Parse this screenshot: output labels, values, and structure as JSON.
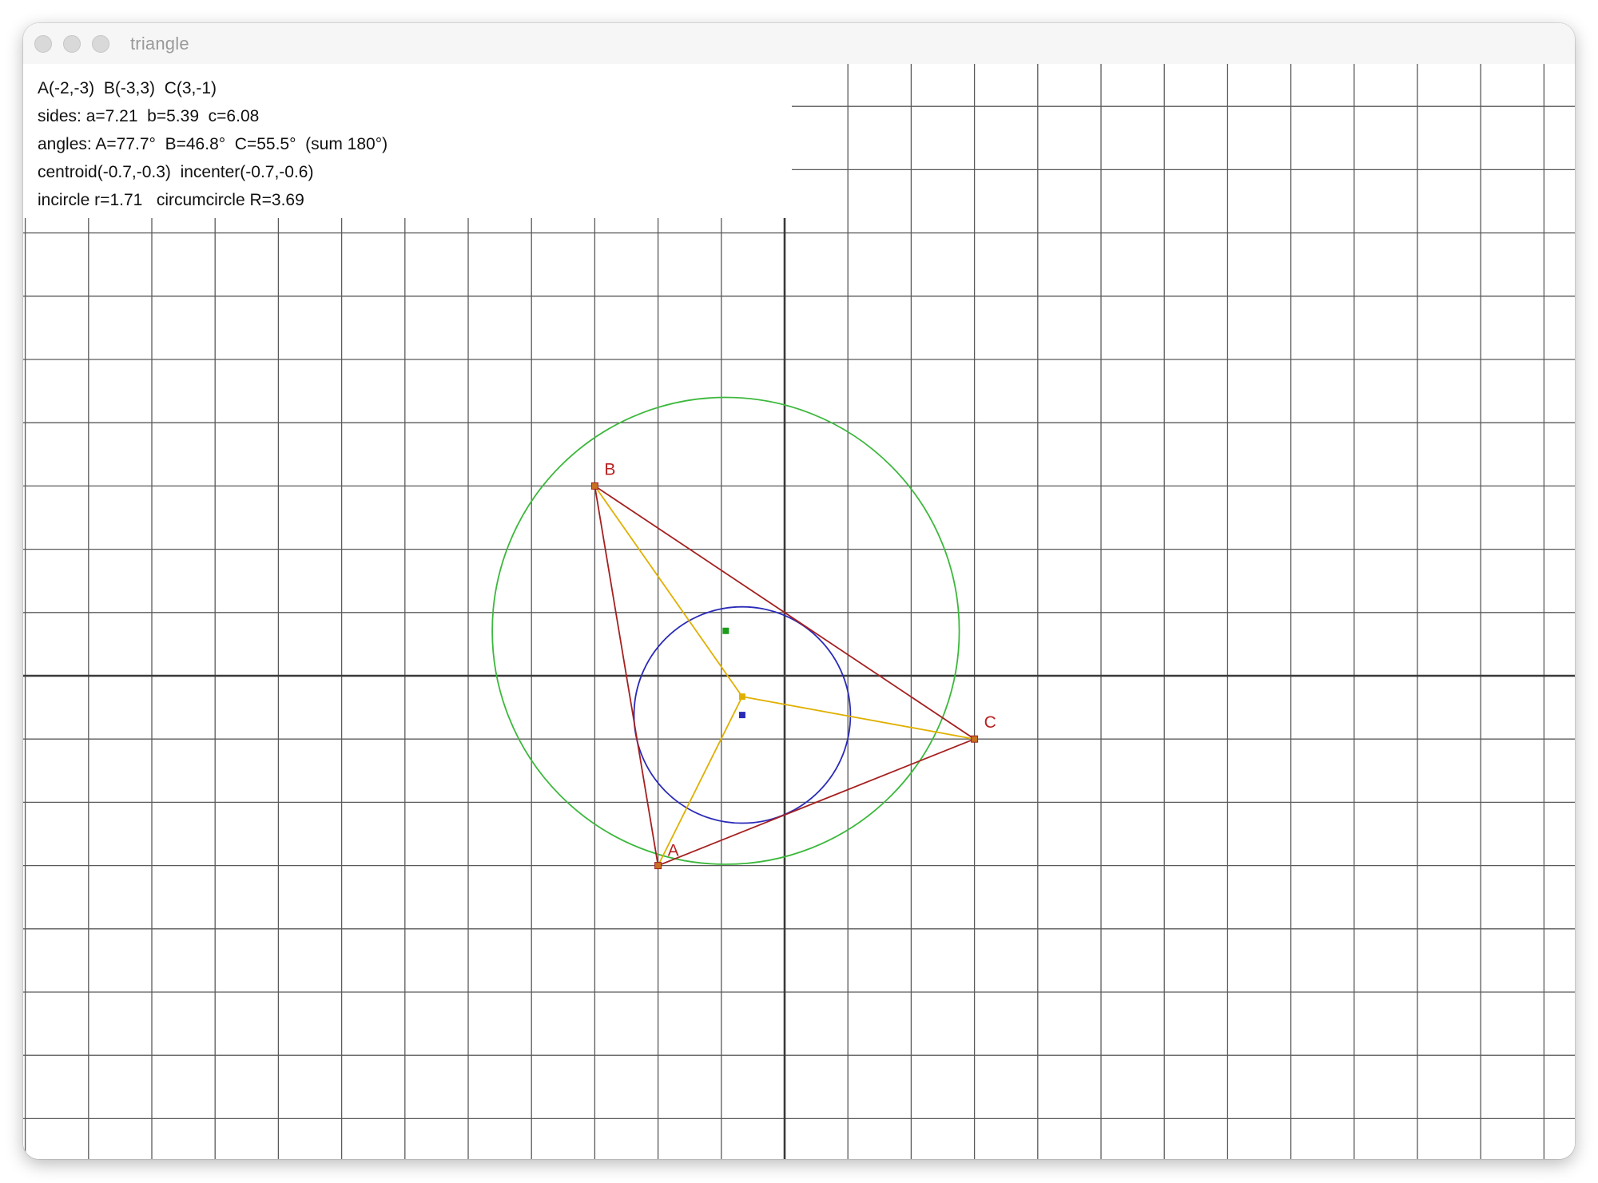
{
  "window": {
    "title": "triangle",
    "controls": [
      "close",
      "minimize",
      "zoom"
    ]
  },
  "info": {
    "line1": "A(-2,-3)  B(-3,3)  C(3,-1)",
    "line2": "sides: a=7.21  b=5.39  c=6.08",
    "line3": "angles: A=77.7°  B=46.8°  C=55.5°  (sum 180°)",
    "line4": "centroid(-0.7,-0.3)  incenter(-0.7,-0.6)",
    "line5": "incircle r=1.71   circumcircle R=3.69"
  },
  "colors": {
    "grid": "#5a5a5a",
    "axis": "#3a3a3a",
    "triangle": "#a52020",
    "incircle": "#2a2ab8",
    "circumcircle": "#3cb83c",
    "medians": "#e0b000",
    "vertex_label": "#b82020",
    "incenter_marker": "#2a2ab8",
    "circumcenter_marker": "#1c9c1c",
    "centroid_marker": "#e0b000"
  },
  "geometry": {
    "vertices": [
      {
        "label": "A",
        "x": -2,
        "y": -3
      },
      {
        "label": "B",
        "x": -3,
        "y": 3
      },
      {
        "label": "C",
        "x": 3,
        "y": -1
      }
    ],
    "centroid": {
      "x": -0.67,
      "y": -0.33
    },
    "incenter": {
      "x": -0.67,
      "y": -0.62
    },
    "incircle_r": 1.71,
    "circumcenter": {
      "x": -0.93,
      "y": 0.71
    },
    "circumcircle_R": 3.69
  }
}
